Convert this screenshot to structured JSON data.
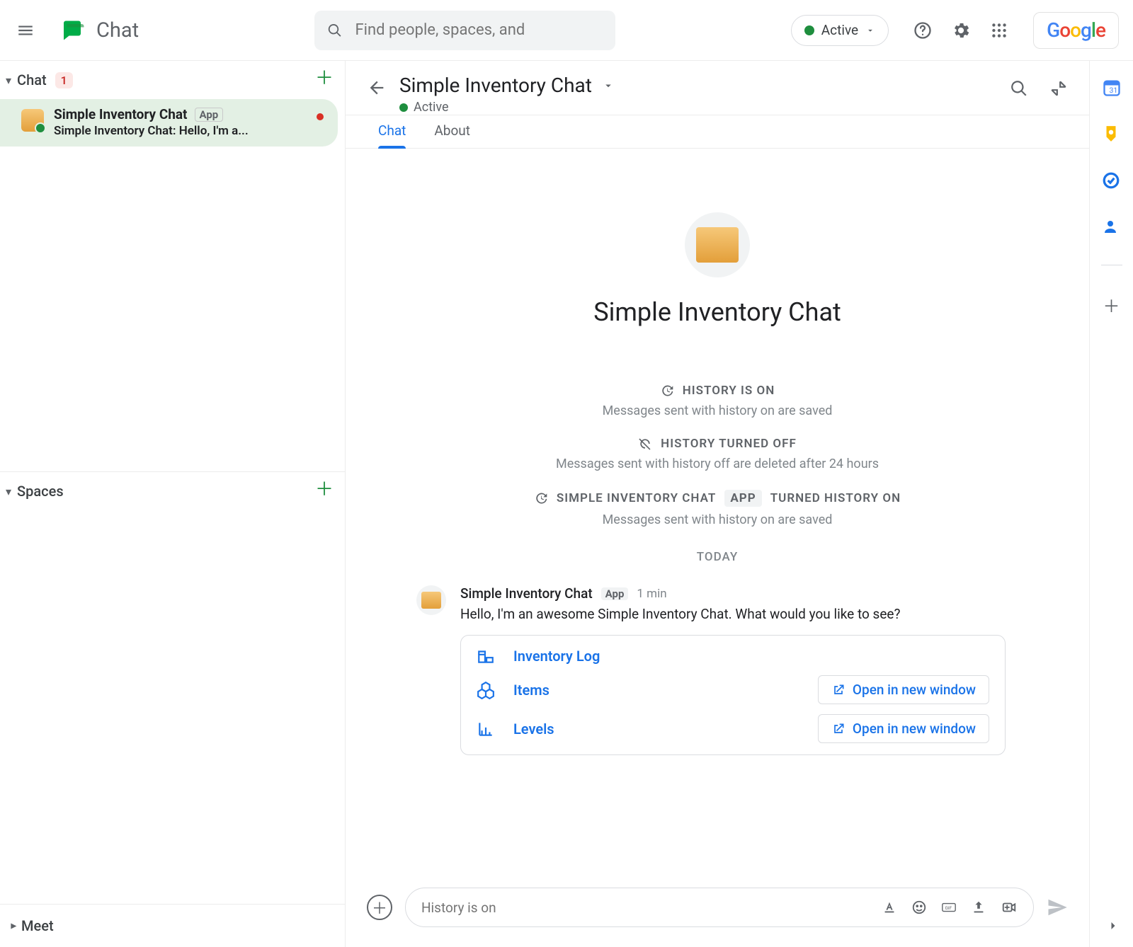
{
  "header": {
    "app_title": "Chat",
    "search_placeholder": "Find people, spaces, and",
    "status_label": "Active"
  },
  "sidebar": {
    "chat_label": "Chat",
    "chat_badge": "1",
    "spaces_label": "Spaces",
    "meet_label": "Meet",
    "conversation": {
      "name": "Simple Inventory Chat",
      "tag": "App",
      "preview": "Simple Inventory Chat: Hello, I'm a..."
    }
  },
  "chat": {
    "title": "Simple Inventory Chat",
    "status": "Active",
    "tabs": {
      "chat": "Chat",
      "about": "About"
    }
  },
  "hero": {
    "title": "Simple Inventory Chat",
    "history_on": "HISTORY IS ON",
    "history_on_desc": "Messages sent with history on are saved",
    "history_off": "HISTORY TURNED OFF",
    "history_off_desc": "Messages sent with history off are deleted after 24 hours",
    "history_turned_on_prefix": "SIMPLE INVENTORY CHAT",
    "app_chip": "APP",
    "history_turned_on_suffix": "TURNED HISTORY ON",
    "history_turned_on_desc": "Messages sent with history on are saved",
    "today": "TODAY"
  },
  "message": {
    "name": "Simple Inventory Chat",
    "tag": "App",
    "time": "1 min",
    "text": "Hello, I'm an awesome  Simple Inventory Chat. What would you like to see?",
    "card": {
      "rows": [
        {
          "label": "Inventory Log"
        },
        {
          "label": "Items"
        },
        {
          "label": "Levels"
        }
      ],
      "open_label": "Open in new window"
    }
  },
  "composer": {
    "placeholder": "History is on"
  }
}
